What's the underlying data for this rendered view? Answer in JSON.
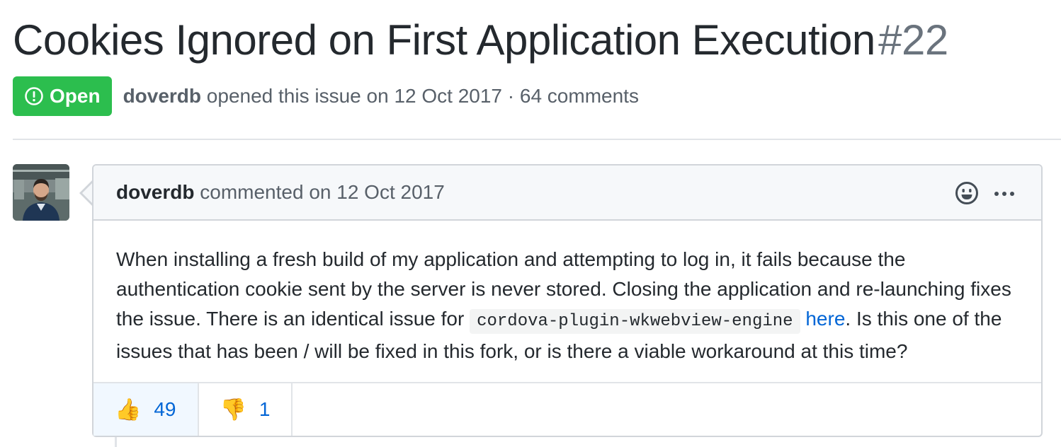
{
  "issue": {
    "title": "Cookies Ignored on First Application Execution",
    "number": "#22",
    "state_label": "Open",
    "author": "doverdb",
    "meta_text": " opened this issue on 12 Oct 2017 · 64 comments"
  },
  "comment": {
    "author": "doverdb",
    "meta_text": " commented on 12 Oct 2017",
    "body_part1": "When installing a fresh build of my application and attempting to log in, it fails because the authentication cookie sent by the server is never stored. Closing the application and re-launching fixes the issue. There is an identical issue for ",
    "code": "cordova-plugin-wkwebview-engine",
    "link_text": "here",
    "body_part2": ". Is this one of the issues that has been / will be fixed in this fork, or is there a viable workaround at this time?"
  },
  "reactions": [
    {
      "emoji": "👍",
      "icon": "thumbs-up-icon",
      "count": "49"
    },
    {
      "emoji": "👎",
      "icon": "thumbs-down-icon",
      "count": "1"
    }
  ],
  "colors": {
    "open_badge": "#2cbe4e",
    "link": "#0366d6",
    "muted": "#586069"
  }
}
